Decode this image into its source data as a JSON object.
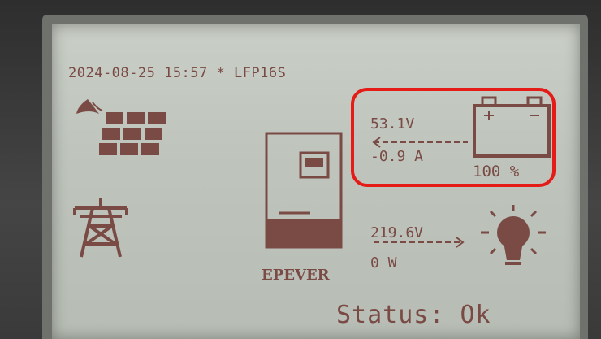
{
  "screen": {
    "header": "2024-08-25 15:57 * LFP16S",
    "brand": "EPEVER",
    "status": "Status: Ok"
  },
  "battery": {
    "voltage": "53.1V",
    "current": "-0.9 A",
    "state_of_charge": "100 %",
    "icon": "battery-icon"
  },
  "load": {
    "voltage": "219.6V",
    "power": "0 W",
    "icon": "lightbulb-icon"
  },
  "pv": {
    "icon": "solar-panel-icon",
    "night_icon": "moon-icon"
  },
  "grid": {
    "icon": "power-tower-icon"
  },
  "inverter": {
    "icon": "inverter-icon"
  },
  "colors": {
    "lcd_background": "#c3c8c0",
    "lcd_foreground": "#7a4a44",
    "highlight": "#e41b17"
  }
}
